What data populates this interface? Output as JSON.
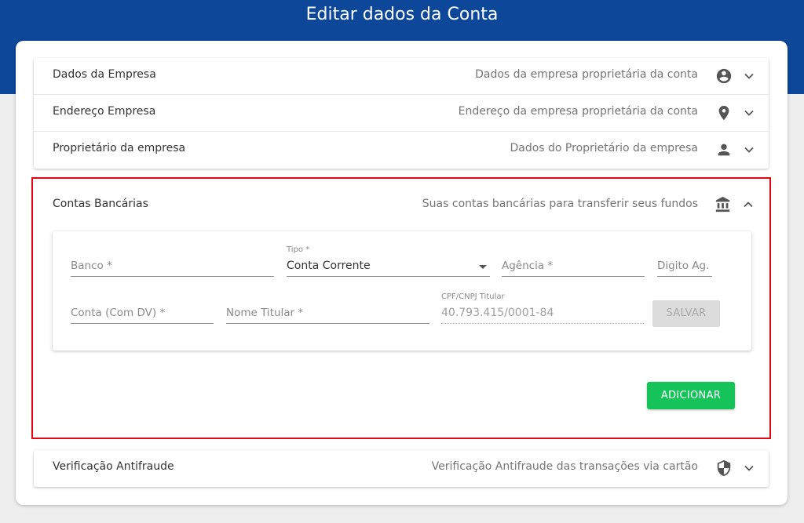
{
  "header": {
    "title": "Editar dados da Conta"
  },
  "colors": {
    "header_bg": "#0d479a",
    "highlight_border": "#e30613",
    "add_button": "#16c35a"
  },
  "sections": [
    {
      "title": "Dados da Empresa",
      "description": "Dados da empresa proprietária da conta",
      "icon": "account-circle-icon"
    },
    {
      "title": "Endereço Empresa",
      "description": "Endereço da empresa proprietária da conta",
      "icon": "location-pin-icon"
    },
    {
      "title": "Proprietário da empresa",
      "description": "Dados do Proprietário da empresa",
      "icon": "person-icon"
    }
  ],
  "bank_section": {
    "title": "Contas Bancárias",
    "description": "Suas contas bancárias para transferir seus fundos",
    "icon": "bank-icon",
    "form": {
      "banco_placeholder": "Banco *",
      "tipo_label": "Tipo *",
      "tipo_value": "Conta Corrente",
      "agencia_placeholder": "Agência *",
      "digito_placeholder": "Digito Ag.",
      "conta_placeholder": "Conta (Com DV) *",
      "nome_placeholder": "Nome Titular *",
      "cpf_label": "CPF/CNPJ Titular",
      "cpf_value": "40.793.415/0001-84",
      "save_label": "SALVAR"
    },
    "add_label": "ADICIONAR"
  },
  "antifraud_section": {
    "title": "Verificação Antifraude",
    "description": "Verificação Antifraude das transações via cartão",
    "icon": "shield-icon"
  }
}
